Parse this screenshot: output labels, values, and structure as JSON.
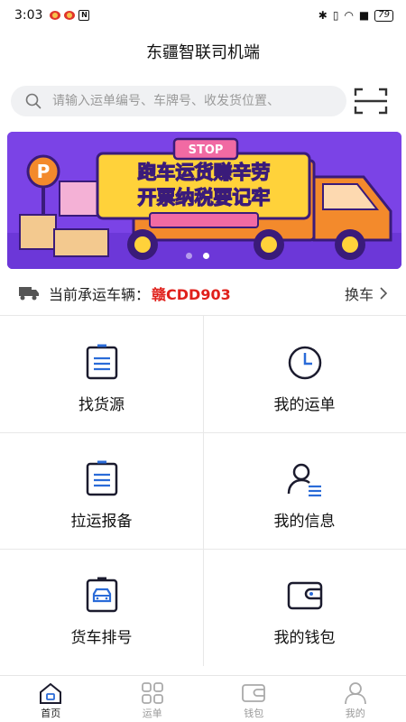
{
  "status_bar": {
    "time": "3:03",
    "battery": "79"
  },
  "header": {
    "title": "东疆智联司机端"
  },
  "search": {
    "placeholder": "请输入运单编号、车牌号、收发货位置、"
  },
  "banner": {
    "sign_text": "STOP",
    "line1": "跑车运货赚辛劳",
    "line2": "开票纳税要记牢",
    "parking_letter": "P",
    "colors": {
      "bg": "#7b43e6",
      "truck": "#f38a2c",
      "board": "#ffd23a"
    }
  },
  "vehicle": {
    "label": "当前承运车辆：",
    "plate": "赣CDD903",
    "change_label": "换车"
  },
  "grid": [
    {
      "label": "找货源",
      "icon": "list-document-icon"
    },
    {
      "label": "我的运单",
      "icon": "clock-icon"
    },
    {
      "label": "拉运报备",
      "icon": "report-document-icon"
    },
    {
      "label": "我的信息",
      "icon": "user-info-icon"
    },
    {
      "label": "货车排号",
      "icon": "truck-queue-icon"
    },
    {
      "label": "我的钱包",
      "icon": "wallet-icon"
    }
  ],
  "nav": [
    {
      "label": "首页",
      "icon": "home-icon",
      "active": true
    },
    {
      "label": "运单",
      "icon": "grid-icon",
      "active": false
    },
    {
      "label": "钱包",
      "icon": "wallet-icon",
      "active": false
    },
    {
      "label": "我的",
      "icon": "profile-icon",
      "active": false
    }
  ],
  "colors": {
    "accent": "#2a6bd8",
    "plate": "#e0201b"
  }
}
